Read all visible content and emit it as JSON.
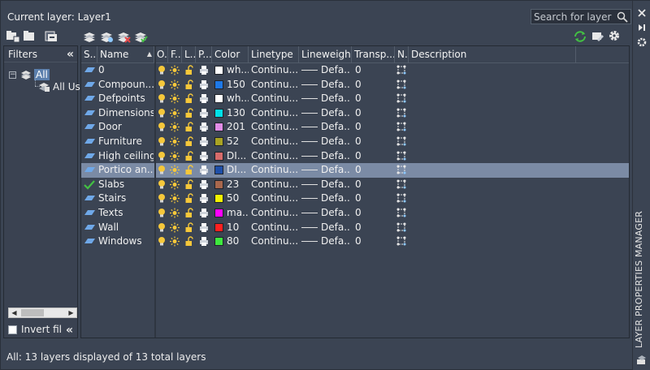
{
  "header": {
    "current_layer": "Current layer: Layer1",
    "search_placeholder": "Search for layer"
  },
  "panel_title": "LAYER PROPERTIES MANAGER",
  "filters": {
    "title": "Filters",
    "tree": {
      "root": "All",
      "child": "All Use"
    },
    "invert_label": "Invert fil"
  },
  "columns": [
    "S...",
    "Name",
    "O...",
    "F...",
    "L...",
    "P...",
    "Color",
    "Linetype",
    "Lineweight",
    "Transp...",
    "N...",
    "Description"
  ],
  "layers": [
    {
      "name": "0",
      "color_name": "wh...",
      "color_hex": "#ffffff",
      "linetype": "Continu...",
      "lineweight": "Defa...",
      "transparency": "0",
      "current": false,
      "selected": false
    },
    {
      "name": "Compoun...",
      "color_name": "150",
      "color_hex": "#1e78e6",
      "linetype": "Continu...",
      "lineweight": "Defa...",
      "transparency": "0",
      "current": false,
      "selected": false
    },
    {
      "name": "Defpoints",
      "color_name": "wh...",
      "color_hex": "#ffffff",
      "linetype": "Continu...",
      "lineweight": "Defa...",
      "transparency": "0",
      "current": false,
      "selected": false
    },
    {
      "name": "Dimensions",
      "color_name": "130",
      "color_hex": "#00e0e8",
      "linetype": "Continu...",
      "lineweight": "Defa...",
      "transparency": "0",
      "current": false,
      "selected": false
    },
    {
      "name": "Door",
      "color_name": "201",
      "color_hex": "#e08ce6",
      "linetype": "Continu...",
      "lineweight": "Defa...",
      "transparency": "0",
      "current": false,
      "selected": false
    },
    {
      "name": "Furniture",
      "color_name": "52",
      "color_hex": "#a9a323",
      "linetype": "Continu...",
      "lineweight": "Defa...",
      "transparency": "0",
      "current": false,
      "selected": false
    },
    {
      "name": "High ceiling",
      "color_name": "DI...",
      "color_hex": "#d76b6b",
      "linetype": "Continu...",
      "lineweight": "Defa...",
      "transparency": "0",
      "current": false,
      "selected": false
    },
    {
      "name": "Portico an...",
      "color_name": "DI...",
      "color_hex": "#1e4fa8",
      "linetype": "Continu...",
      "lineweight": "Defa...",
      "transparency": "0",
      "current": false,
      "selected": true
    },
    {
      "name": "Slabs",
      "color_name": "23",
      "color_hex": "#a8674d",
      "linetype": "Continu...",
      "lineweight": "Defa...",
      "transparency": "0",
      "current": true,
      "selected": false
    },
    {
      "name": "Stairs",
      "color_name": "50",
      "color_hex": "#f2f200",
      "linetype": "Continu...",
      "lineweight": "Defa...",
      "transparency": "0",
      "current": false,
      "selected": false
    },
    {
      "name": "Texts",
      "color_name": "ma...",
      "color_hex": "#ff00ff",
      "linetype": "Continu...",
      "lineweight": "Defa...",
      "transparency": "0",
      "current": false,
      "selected": false
    },
    {
      "name": "Wall",
      "color_name": "10",
      "color_hex": "#ff2020",
      "linetype": "Continu...",
      "lineweight": "Defa...",
      "transparency": "0",
      "current": false,
      "selected": false
    },
    {
      "name": "Windows",
      "color_name": "80",
      "color_hex": "#3ee83e",
      "linetype": "Continu...",
      "lineweight": "Defa...",
      "transparency": "0",
      "current": false,
      "selected": false
    }
  ],
  "status": "All: 13 layers displayed of 13 total layers",
  "colors": {
    "background": "#3b4453",
    "selected_row": "#7b8ba5",
    "current_check": "#43c043",
    "bulb": "#f5c73a"
  }
}
